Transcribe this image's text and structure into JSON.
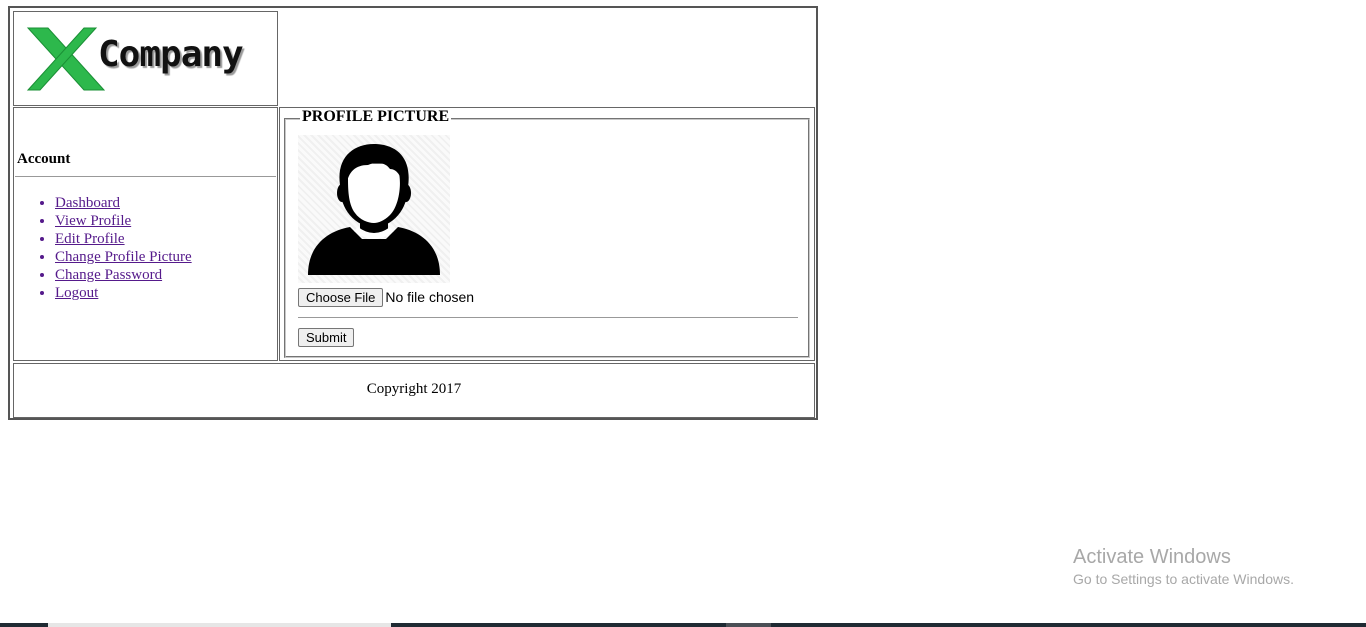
{
  "header": {
    "logo_text": "Company",
    "logo_colors": {
      "x_green": "#2db84c",
      "x_dark": "#1a8f35"
    }
  },
  "sidebar": {
    "title": "Account",
    "items": [
      {
        "label": "Dashboard"
      },
      {
        "label": "View Profile"
      },
      {
        "label": "Edit Profile"
      },
      {
        "label": "Change Profile Picture"
      },
      {
        "label": "Change Password"
      },
      {
        "label": "Logout"
      }
    ]
  },
  "main": {
    "legend": "PROFILE PICTURE",
    "avatar_icon": "user-silhouette-icon",
    "file_button_label": "Choose File",
    "file_status": "No file chosen",
    "submit_label": "Submit"
  },
  "footer": {
    "copyright": "Copyright 2017"
  },
  "watermark": {
    "title": "Activate Windows",
    "subtitle": "Go to Settings to activate Windows."
  }
}
